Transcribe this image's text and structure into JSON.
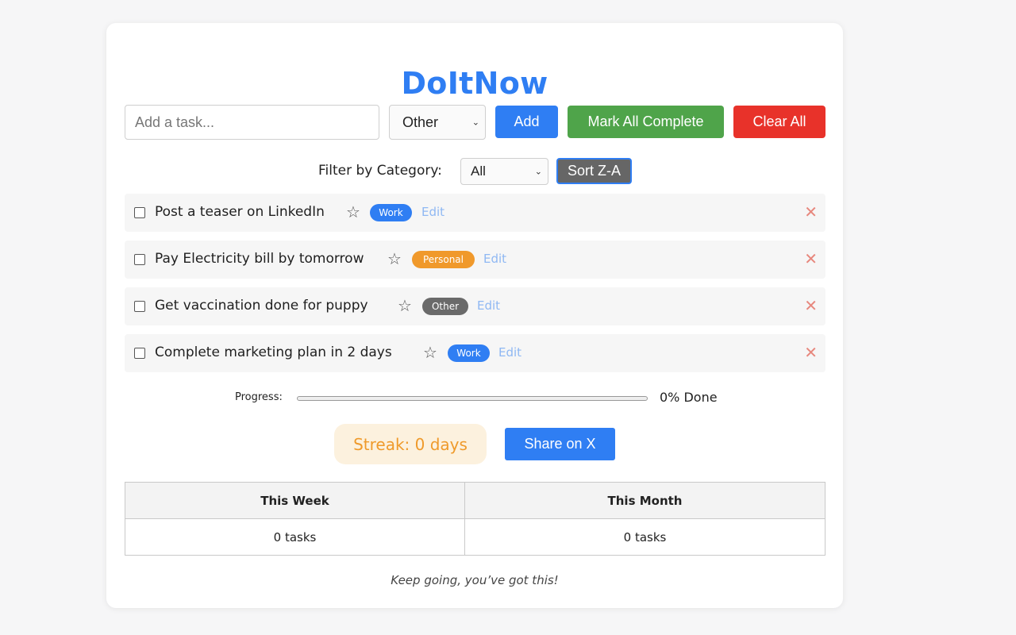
{
  "app": {
    "title": "DoItNow"
  },
  "input_row": {
    "task_placeholder": "Add a task...",
    "task_value": "",
    "category_selected": "Other",
    "add_label": "Add",
    "mark_all_label": "Mark All Complete",
    "clear_all_label": "Clear All"
  },
  "filter": {
    "label": "Filter by Category:",
    "selected": "All",
    "sort_label": "Sort Z-A"
  },
  "tasks": [
    {
      "text": "Post a teaser on LinkedIn",
      "category": "Work",
      "edit_label": "Edit",
      "starred": false,
      "completed": false
    },
    {
      "text": "Pay Electricity bill by tomorrow",
      "category": "Personal",
      "edit_label": "Edit",
      "starred": false,
      "completed": false
    },
    {
      "text": "Get vaccination done for puppy",
      "category": "Other",
      "edit_label": "Edit",
      "starred": false,
      "completed": false
    },
    {
      "text": "Complete marketing plan in 2 days",
      "category": "Work",
      "edit_label": "Edit",
      "starred": false,
      "completed": false
    }
  ],
  "category_colors": {
    "Work": "#2f7ef3",
    "Personal": "#f0992b",
    "Other": "#6a6a6a"
  },
  "progress": {
    "label": "Progress:",
    "percent": 0,
    "text": "0% Done"
  },
  "streak": {
    "text": "Streak: 0 days"
  },
  "share": {
    "label": "Share on X"
  },
  "stats": {
    "headers": [
      "This Week",
      "This Month"
    ],
    "values": [
      "0 tasks",
      "0 tasks"
    ]
  },
  "motto": "Keep going, you’ve got this!",
  "colors": {
    "accent": "#2f7ef3",
    "success": "#4fa44a",
    "danger": "#e8322a",
    "sort_button": "#666666"
  }
}
